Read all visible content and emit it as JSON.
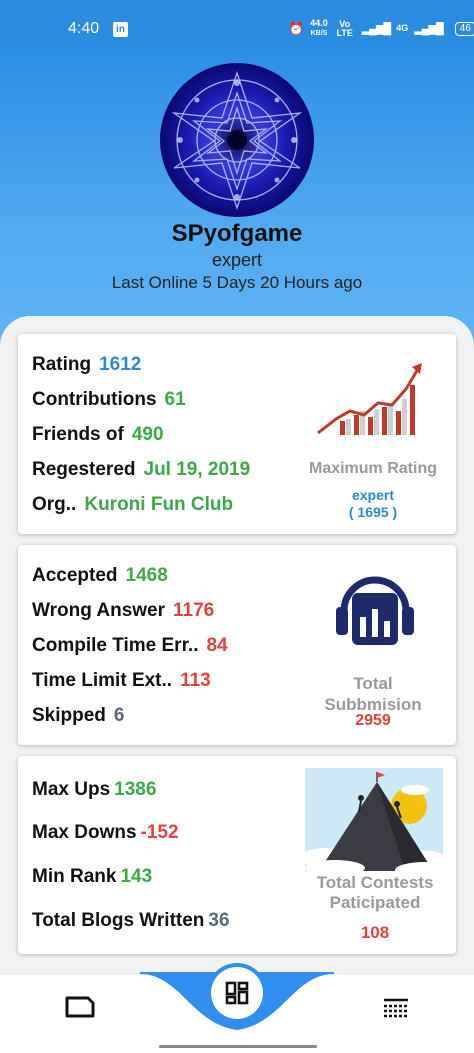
{
  "status_bar": {
    "time": "4:40",
    "notification_icon": "linkedin-icon",
    "network_speed": "44.0",
    "network_speed_unit": "KB/S",
    "volte": "Vo LTE",
    "network_type": "4G",
    "battery": "46"
  },
  "profile": {
    "handle": "SPyofgame",
    "rank": "expert",
    "last_online": "Last Online 5 Days 20 Hours ago"
  },
  "rating_card": {
    "rows": [
      {
        "label": "Rating",
        "value": "1612"
      },
      {
        "label": "Contributions",
        "value": "61"
      },
      {
        "label": "Friends of",
        "value": "490"
      },
      {
        "label": "Regestered",
        "value": "Jul 19, 2019"
      },
      {
        "label": "Org..",
        "value": "Kuroni Fun Club"
      }
    ],
    "side_title": "Maximum Rating",
    "max_rank": "expert",
    "max_rating": "( 1695 )"
  },
  "submission_card": {
    "rows": [
      {
        "label": "Accepted",
        "value": "1468"
      },
      {
        "label": "Wrong Answer",
        "value": "1176"
      },
      {
        "label": "Compile Time Err..",
        "value": "84"
      },
      {
        "label": "Time Limit Ext..",
        "value": "113"
      },
      {
        "label": "Skipped",
        "value": "6"
      }
    ],
    "side_title_line1": "Total",
    "side_title_line2": "Subbmision",
    "total": "2959"
  },
  "contest_card": {
    "rows": [
      {
        "label": "Max Ups",
        "value": "1386"
      },
      {
        "label": "Max Downs",
        "value": "-152"
      },
      {
        "label": "Min Rank",
        "value": "143"
      },
      {
        "label": "Total Blogs Written",
        "value": "36"
      }
    ],
    "side_title_line1": "Total Contests",
    "side_title_line2": "Paticipated",
    "total": "108"
  },
  "bottom_nav": {
    "items": [
      "blog-icon",
      "dashboard-icon",
      "list-icon"
    ],
    "active": "dashboard-icon"
  },
  "colors": {
    "header_blue": "#2a8ce0",
    "rating_blue": "#2d89d6",
    "green": "#3ea84a",
    "red": "#e0443a",
    "slate": "#5a6b7a",
    "navy_icon": "#1f2a6b"
  }
}
